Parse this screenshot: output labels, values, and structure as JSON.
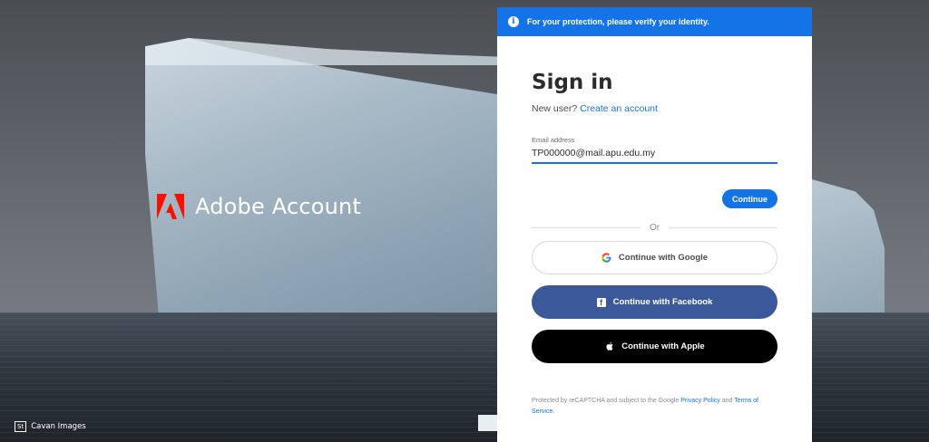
{
  "brand": {
    "name": "Adobe Account"
  },
  "credit": {
    "badge": "St",
    "text": "Cavan Images"
  },
  "banner": {
    "text": "For your protection, please verify your identity."
  },
  "signin": {
    "title": "Sign in",
    "new_user_prefix": "New user?",
    "create_account": "Create an account",
    "email_label": "Email address",
    "email_value": "TP000000@mail.apu.edu.my",
    "continue_label": "Continue",
    "or_label": "Or",
    "google_label": "Continue with Google",
    "facebook_label": "Continue with Facebook",
    "apple_label": "Continue with Apple"
  },
  "legal": {
    "prefix": "Protected by reCAPTCHA and subject to the Google",
    "privacy": "Privacy Policy",
    "and": "and",
    "terms": "Terms of Service",
    "suffix": "."
  },
  "colors": {
    "accent": "#1473e6",
    "facebook": "#3b5998",
    "apple": "#000000",
    "adobe_red": "#fa0f00"
  }
}
